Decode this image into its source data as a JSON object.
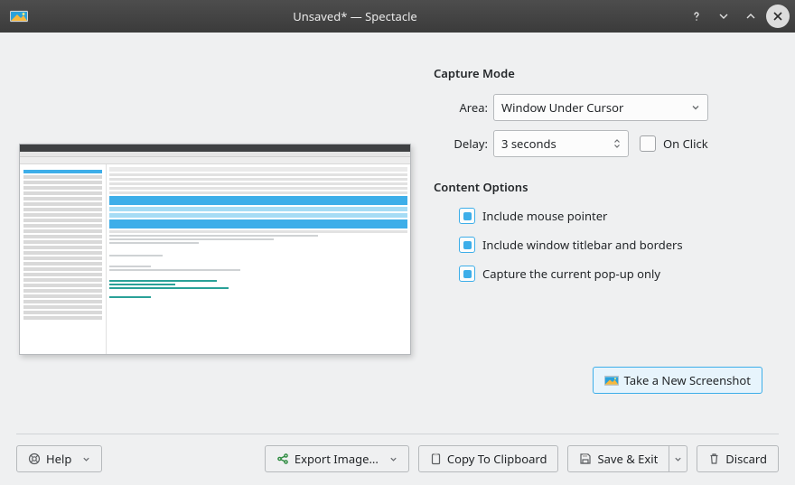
{
  "window": {
    "title": "Unsaved* — Spectacle"
  },
  "capture": {
    "section_title": "Capture Mode",
    "area_label": "Area:",
    "area_value": "Window Under Cursor",
    "delay_label": "Delay:",
    "delay_value": "3 seconds",
    "onclick_label": "On Click",
    "onclick_checked": false
  },
  "content": {
    "section_title": "Content Options",
    "opt_pointer": "Include mouse pointer",
    "opt_pointer_checked": true,
    "opt_titlebar": "Include window titlebar and borders",
    "opt_titlebar_checked": true,
    "opt_popup": "Capture the current pop-up only",
    "opt_popup_checked": true
  },
  "actions": {
    "take": "Take a New Screenshot",
    "help": "Help",
    "export": "Export Image...",
    "copy": "Copy To Clipboard",
    "save": "Save & Exit",
    "discard": "Discard"
  }
}
